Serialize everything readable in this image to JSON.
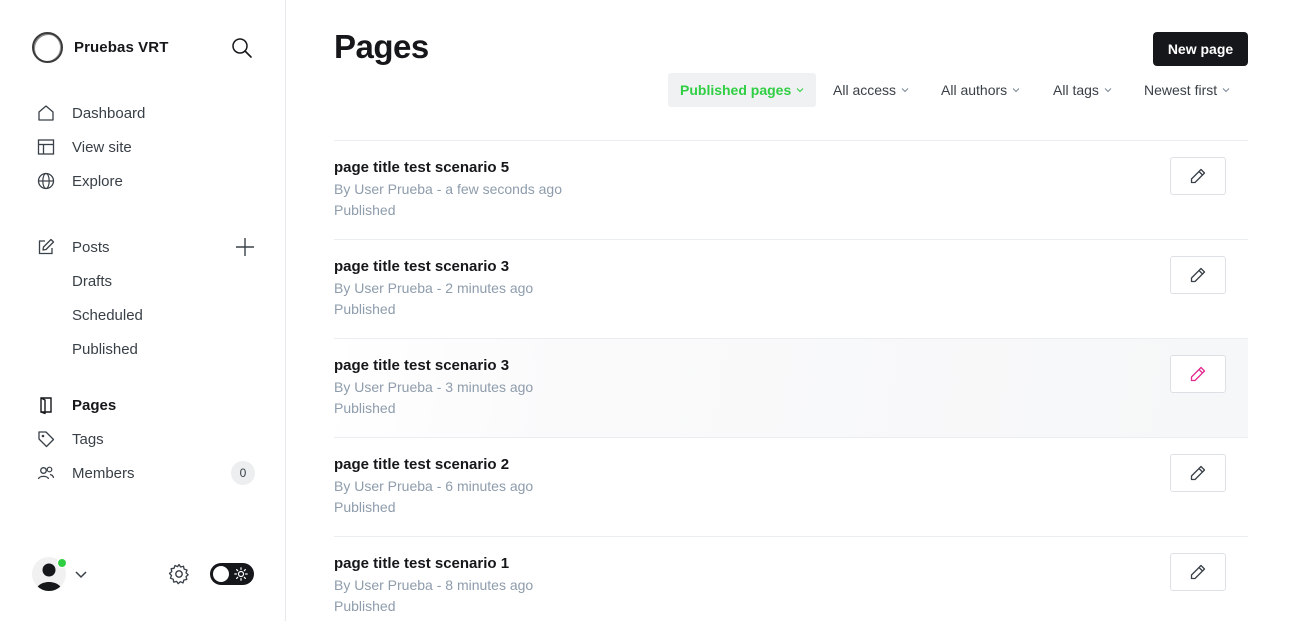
{
  "brand": {
    "name": "Pruebas VRT"
  },
  "sidebar": {
    "primary": [
      {
        "label": "Dashboard",
        "icon": "house-icon"
      },
      {
        "label": "View site",
        "icon": "layout-icon"
      },
      {
        "label": "Explore",
        "icon": "globe-icon"
      }
    ],
    "posts": {
      "label": "Posts",
      "icon": "edit-icon"
    },
    "post_sub": [
      {
        "label": "Drafts"
      },
      {
        "label": "Scheduled"
      },
      {
        "label": "Published"
      }
    ],
    "secondary": [
      {
        "label": "Pages",
        "icon": "page-icon",
        "active": true
      },
      {
        "label": "Tags",
        "icon": "tag-icon"
      },
      {
        "label": "Members",
        "icon": "members-icon",
        "count": "0"
      }
    ]
  },
  "main": {
    "title": "Pages",
    "new_button": "New page",
    "filters": [
      {
        "label": "Published pages",
        "active": true
      },
      {
        "label": "All access"
      },
      {
        "label": "All authors"
      },
      {
        "label": "All tags"
      },
      {
        "label": "Newest first"
      }
    ],
    "pages": [
      {
        "title": "page title test scenario 5",
        "meta": "By User Prueba - a few seconds ago",
        "status": "Published"
      },
      {
        "title": "page title test scenario 3",
        "meta": "By User Prueba - 2 minutes ago",
        "status": "Published"
      },
      {
        "title": "page title test scenario 3",
        "meta": "By User Prueba - 3 minutes ago",
        "status": "Published",
        "hovered": true
      },
      {
        "title": "page title test scenario 2",
        "meta": "By User Prueba - 6 minutes ago",
        "status": "Published"
      },
      {
        "title": "page title test scenario 1",
        "meta": "By User Prueba - 8 minutes ago",
        "status": "Published"
      }
    ]
  },
  "colors": {
    "accent_green": "#30cf43",
    "hover_edit_pink": "#e22a8e",
    "text_dark": "#15171a",
    "text_muted": "#8e9cac"
  }
}
